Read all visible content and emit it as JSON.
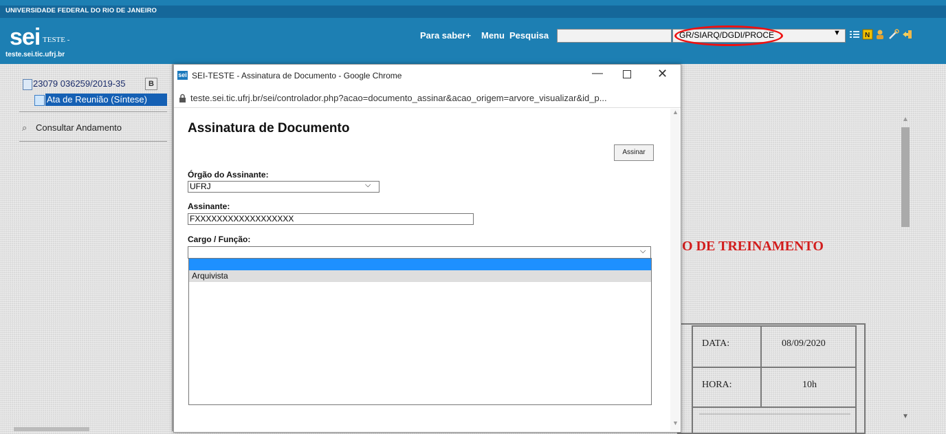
{
  "header": {
    "university": "UNIVERSIDADE FEDERAL DO RIO DE JANEIRO",
    "logo": "sei",
    "logo_sub": "TESTE -",
    "host": "teste.sei.tic.ufrj.br",
    "links": [
      "Para saber+",
      "Menu",
      "Pesquisa"
    ],
    "search_value": "",
    "unit_selected": "GR/SIARQ/DGDI/PROCE",
    "icons": [
      "list-icon",
      "notes-icon",
      "user-icon",
      "tools-icon",
      "exit-icon"
    ],
    "colors": {
      "bar": "#1d7fb3",
      "top_strip": "#15679a",
      "highlight_ellipse": "#e11111"
    }
  },
  "tree": {
    "process_number": "23079 036259/2019-35",
    "process_badge": "B",
    "document": "Ata de Reunião (Síntese)",
    "consult_link": "Consultar Andamento"
  },
  "document": {
    "title_fragment": "O DE TREINAMENTO",
    "table": [
      {
        "label": "DATA:",
        "value": "08/09/2020"
      },
      {
        "label": "HORA:",
        "value": "10h"
      }
    ]
  },
  "popup": {
    "window_title": "SEI-TESTE - Assinatura de Documento - Google Chrome",
    "favicon": "sei",
    "url": "teste.sei.tic.ufrj.br/sei/controlador.php?acao=documento_assinar&acao_origem=arvore_visualizar&id_p...",
    "heading": "Assinatura de Documento",
    "sign_button": "Assinar",
    "orgao_label": "Órgão do Assinante:",
    "orgao_value": "UFRJ",
    "assinante_label": "Assinante:",
    "assinante_value": "FXXXXXXXXXXXXXXXXXX",
    "cargo_label": "Cargo / Função:",
    "cargo_value": "",
    "cargo_options": [
      "",
      "Arquivista"
    ],
    "colors": {
      "selected_option": "#1e90ff",
      "hover_option": "#dedede"
    }
  }
}
